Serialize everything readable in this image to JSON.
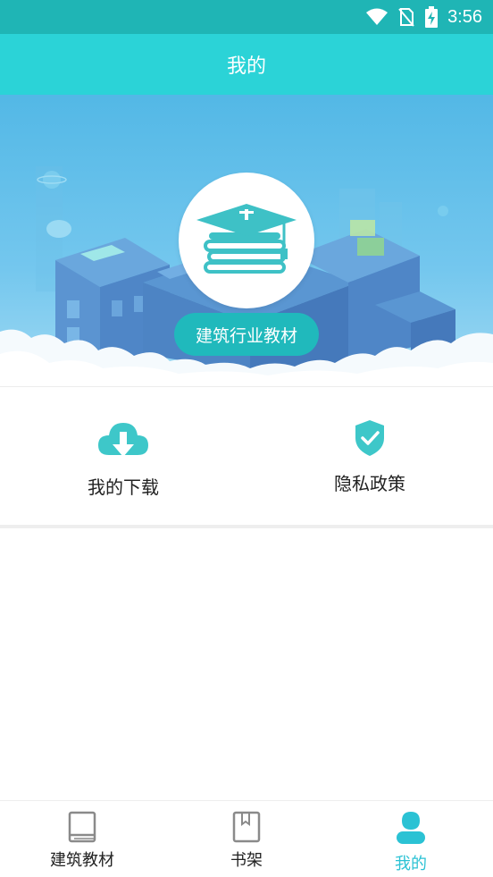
{
  "status_bar": {
    "time": "3:56"
  },
  "header": {
    "title": "我的"
  },
  "hero": {
    "badge_label": "建筑行业教材"
  },
  "actions": [
    {
      "label": "我的下载",
      "icon": "cloud-download-icon"
    },
    {
      "label": "隐私政策",
      "icon": "shield-check-icon"
    }
  ],
  "bottom_nav": [
    {
      "label": "建筑教材",
      "icon": "book-icon",
      "active": false
    },
    {
      "label": "书架",
      "icon": "bookshelf-icon",
      "active": false
    },
    {
      "label": "我的",
      "icon": "user-icon",
      "active": true
    }
  ],
  "colors": {
    "accent": "#2bd3d7",
    "status_bar": "#1fb5b5",
    "pill": "#20b9bc",
    "active_tab": "#2bc2d4"
  }
}
